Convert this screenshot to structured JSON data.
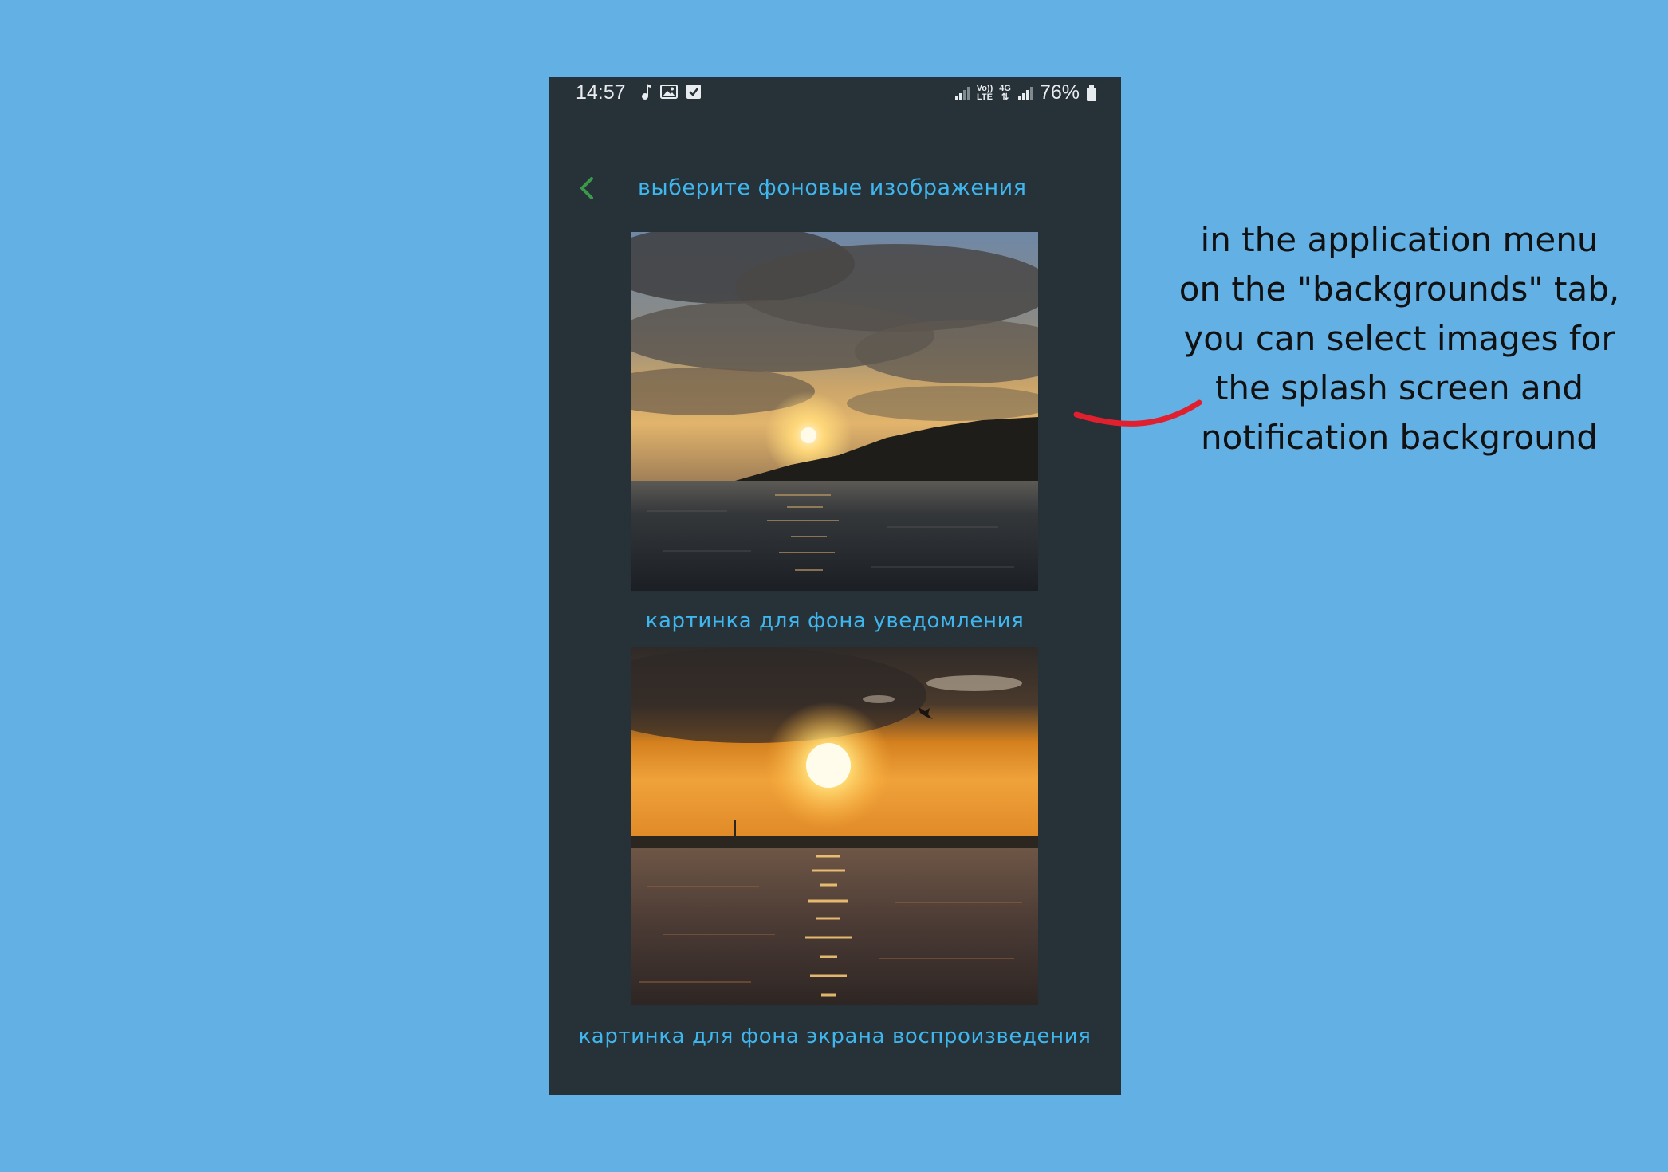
{
  "status_bar": {
    "time": "14:57",
    "left_icons": [
      "music-note-icon",
      "image-icon",
      "checkbox-icon"
    ],
    "volte_label_top": "Vo))",
    "volte_label_bottom": "LTE",
    "network_label": "4G",
    "battery_percent": "76%"
  },
  "toolbar": {
    "back_icon": "chevron-left-icon",
    "title": "выберите фоновые изображения"
  },
  "images": [
    {
      "subject": "sunset over lake with clouds",
      "caption": "картинка для фона уведомления"
    },
    {
      "subject": "sunset over water with bird",
      "caption": "картинка для фона экрана воспроизведения"
    }
  ],
  "annotation": {
    "lines": [
      "in the application menu",
      "on the \"backgrounds\" tab,",
      "you can select images for",
      "the splash screen and",
      "notification background"
    ],
    "arrow_color": "#e0202e"
  },
  "colors": {
    "background": "#63b0e4",
    "phone_bg": "#263138",
    "accent_text": "#3fb6ee",
    "back_icon": "#3a9a4a"
  }
}
